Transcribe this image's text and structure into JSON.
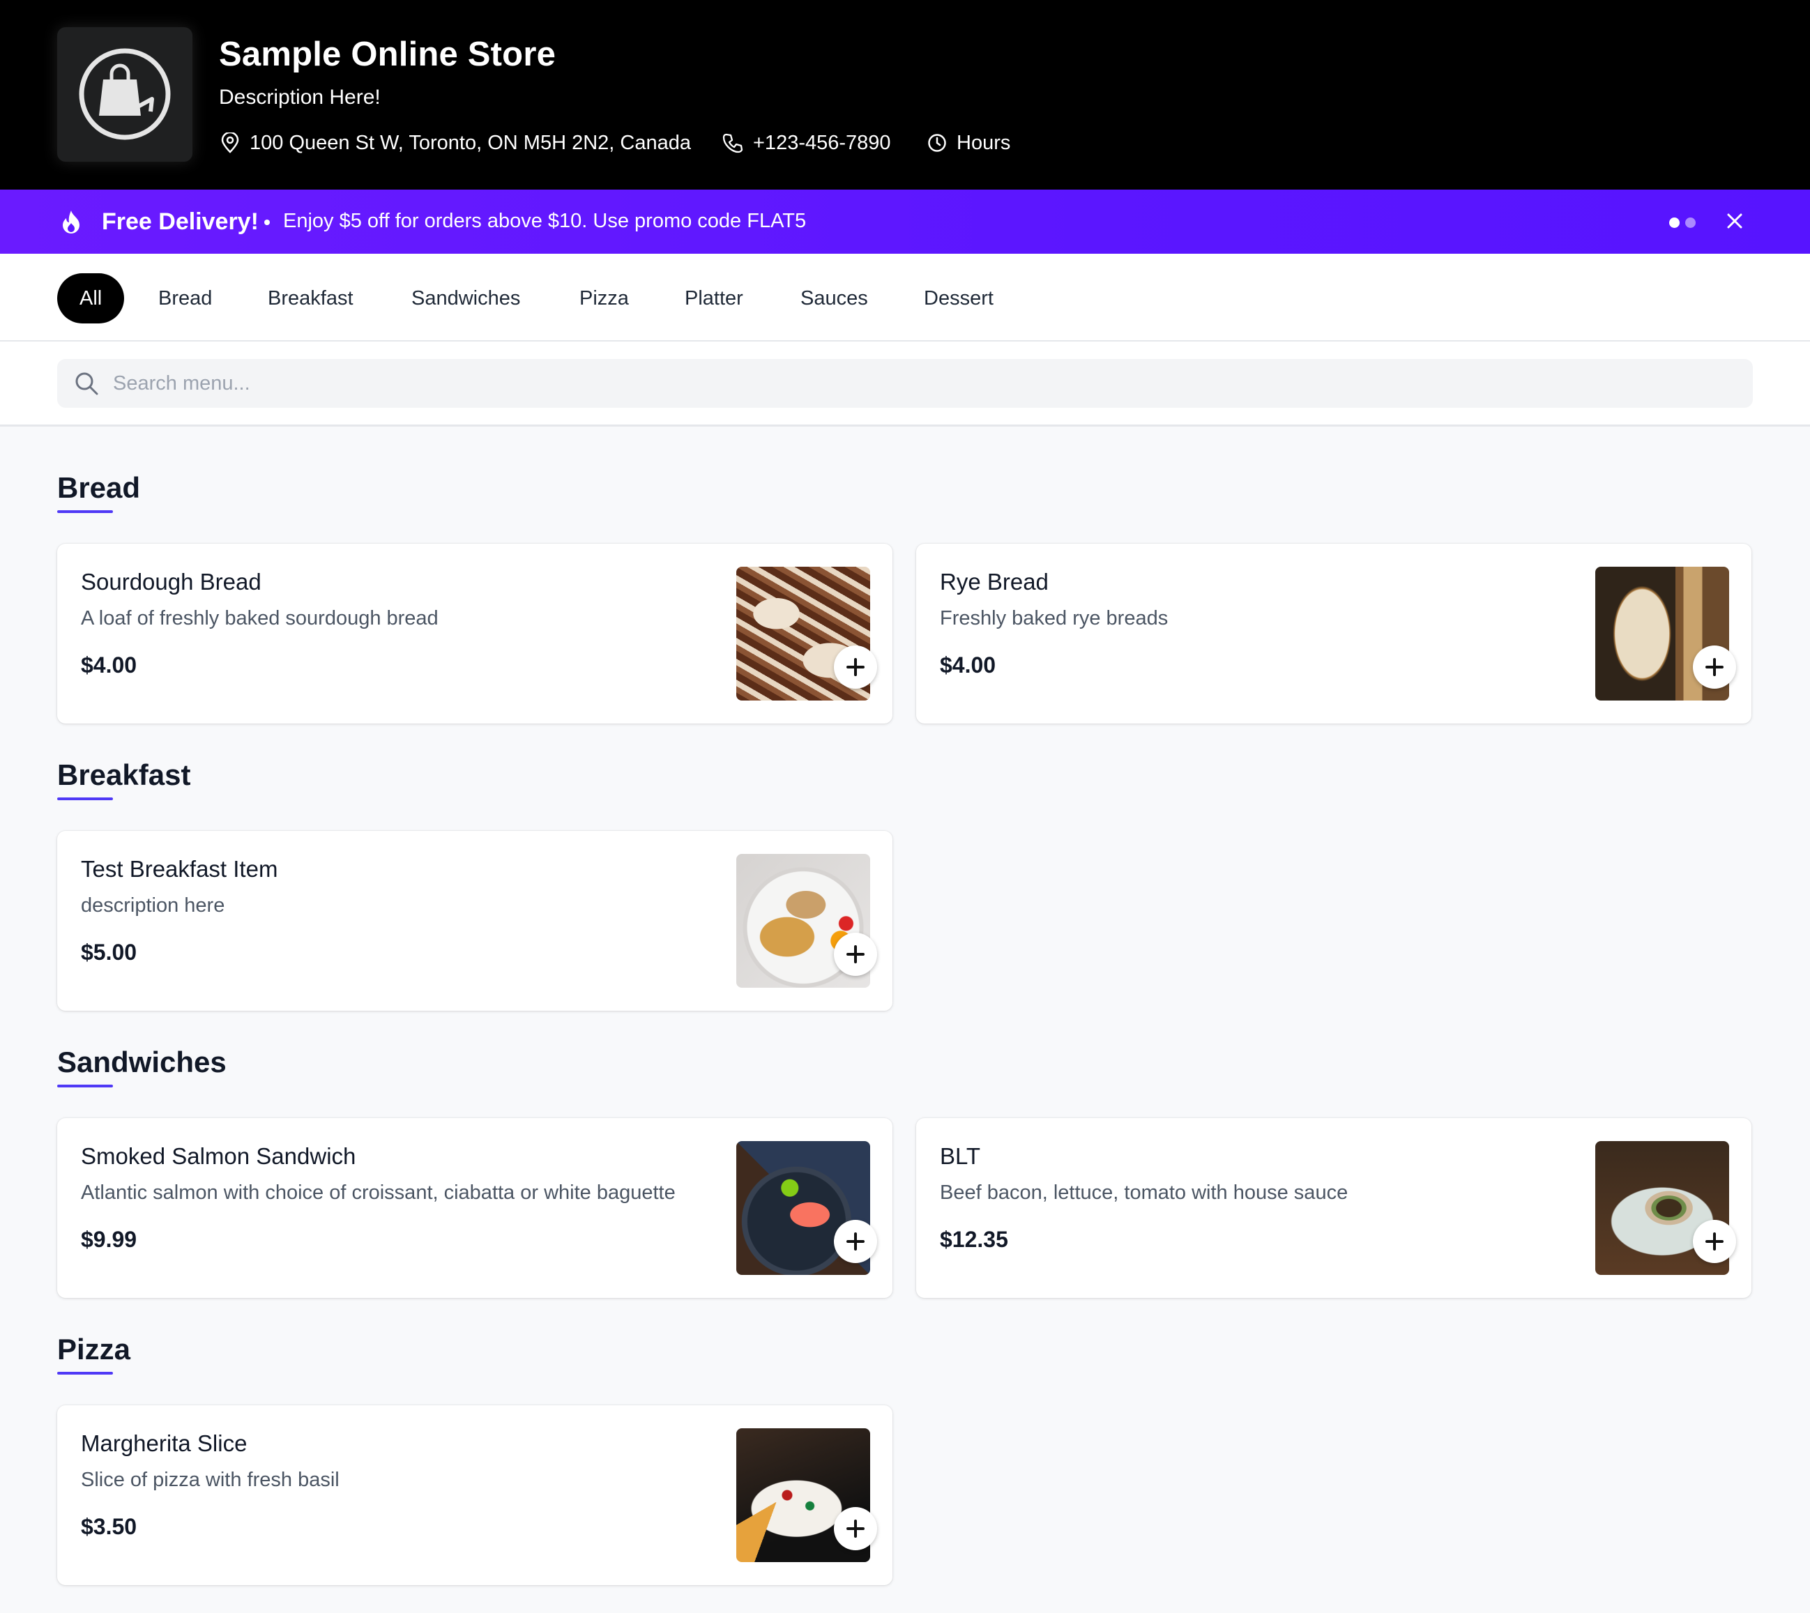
{
  "store": {
    "name": "Sample Online Store",
    "description": "Description Here!",
    "address": "100 Queen St W, Toronto, ON M5H 2N2, Canada",
    "phone": "+123-456-7890",
    "hours_label": "Hours",
    "logo_icon": "shopping-bag-icon"
  },
  "promo": {
    "title": "Free Delivery!",
    "separator": "•",
    "text": "Enjoy $5 off for orders above $10. Use promo code FLAT5",
    "pages_total": 2,
    "page_active": 1,
    "accent": "#5b16ff"
  },
  "categories": {
    "items": [
      "All",
      "Bread",
      "Breakfast",
      "Sandwiches",
      "Pizza",
      "Platter",
      "Sauces",
      "Dessert"
    ],
    "active": "All"
  },
  "search": {
    "placeholder": "Search menu...",
    "value": ""
  },
  "sections": [
    {
      "title": "Bread",
      "items": [
        {
          "name": "Sourdough Bread",
          "description": "A loaf of freshly baked sourdough bread",
          "price": "$4.00"
        },
        {
          "name": "Rye Bread",
          "description": "Freshly baked rye breads",
          "price": "$4.00"
        }
      ]
    },
    {
      "title": "Breakfast",
      "items": [
        {
          "name": "Test Breakfast Item",
          "description": "description here",
          "price": "$5.00"
        }
      ]
    },
    {
      "title": "Sandwiches",
      "items": [
        {
          "name": "Smoked Salmon Sandwich",
          "description": "Atlantic salmon with choice of croissant, ciabatta or white baguette",
          "price": "$9.99"
        },
        {
          "name": "BLT",
          "description": "Beef bacon, lettuce, tomato with house sauce",
          "price": "$12.35"
        }
      ]
    },
    {
      "title": "Pizza",
      "items": [
        {
          "name": "Margherita Slice",
          "description": "Slice of pizza with fresh basil",
          "price": "$3.50"
        }
      ]
    }
  ],
  "colors": {
    "header_bg": "#000000",
    "section_underline": "#4f39f6",
    "page_bg": "#f8f9fb"
  }
}
